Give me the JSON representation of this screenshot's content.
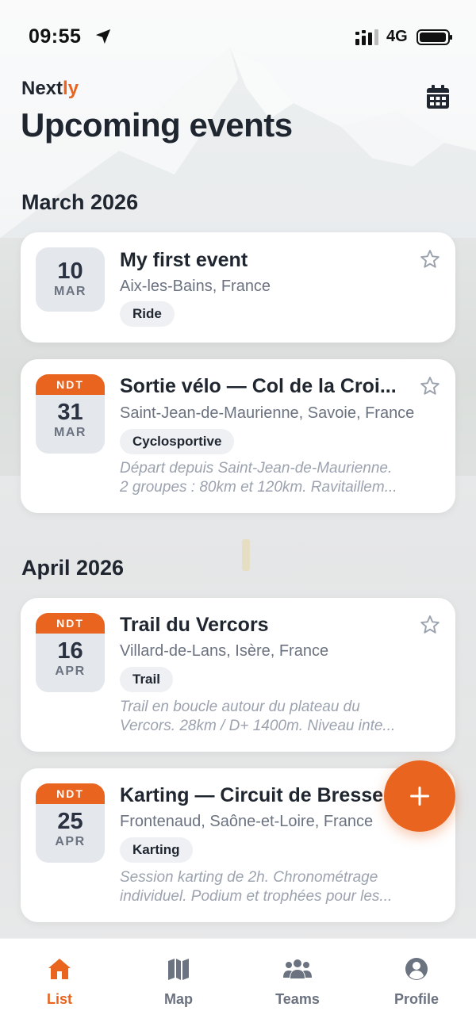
{
  "status_bar": {
    "time": "09:55",
    "network": "4G"
  },
  "header": {
    "brand_prefix": "Next",
    "brand_suffix": "ly",
    "title": "Upcoming events",
    "calendar_icon": "calendar-icon"
  },
  "colors": {
    "accent": "#e8641f",
    "text": "#1f2630",
    "muted": "#6b7280",
    "tag_bg": "#eef0f3",
    "date_bg": "#e4e7ec"
  },
  "sections": [
    {
      "month": "March 2026",
      "events": [
        {
          "day": "10",
          "month": "MAR",
          "badge": "",
          "title": "My first event",
          "location": "Aix-les-Bains, France",
          "tag": "Ride",
          "desc_line1": "",
          "desc_line2": ""
        },
        {
          "day": "31",
          "month": "MAR",
          "badge": "NDT",
          "title": "Sortie vélo — Col de la Croi...",
          "location": "Saint-Jean-de-Maurienne, Savoie, France",
          "tag": "Cyclosportive",
          "desc_line1": "Départ depuis Saint-Jean-de-Maurienne.",
          "desc_line2": "2 groupes : 80km et 120km. Ravitaillem..."
        }
      ]
    },
    {
      "month": "April 2026",
      "events": [
        {
          "day": "16",
          "month": "APR",
          "badge": "NDT",
          "title": "Trail du Vercors",
          "location": "Villard-de-Lans, Isère, France",
          "tag": "Trail",
          "desc_line1": "Trail en boucle autour du plateau du",
          "desc_line2": "Vercors. 28km / D+ 1400m. Niveau inte..."
        },
        {
          "day": "25",
          "month": "APR",
          "badge": "NDT",
          "title": "Karting — Circuit de Bresse",
          "location": "Frontenaud, Saône-et-Loire, France",
          "tag": "Karting",
          "desc_line1": "Session karting de 2h. Chronométrage",
          "desc_line2": "individuel. Podium et trophées pour les..."
        }
      ]
    }
  ],
  "fab": {
    "icon": "plus-icon"
  },
  "tabs": [
    {
      "label": "List",
      "icon": "home-icon",
      "active": true
    },
    {
      "label": "Map",
      "icon": "map-icon",
      "active": false
    },
    {
      "label": "Teams",
      "icon": "users-icon",
      "active": false
    },
    {
      "label": "Profile",
      "icon": "user-circle-icon",
      "active": false
    }
  ]
}
